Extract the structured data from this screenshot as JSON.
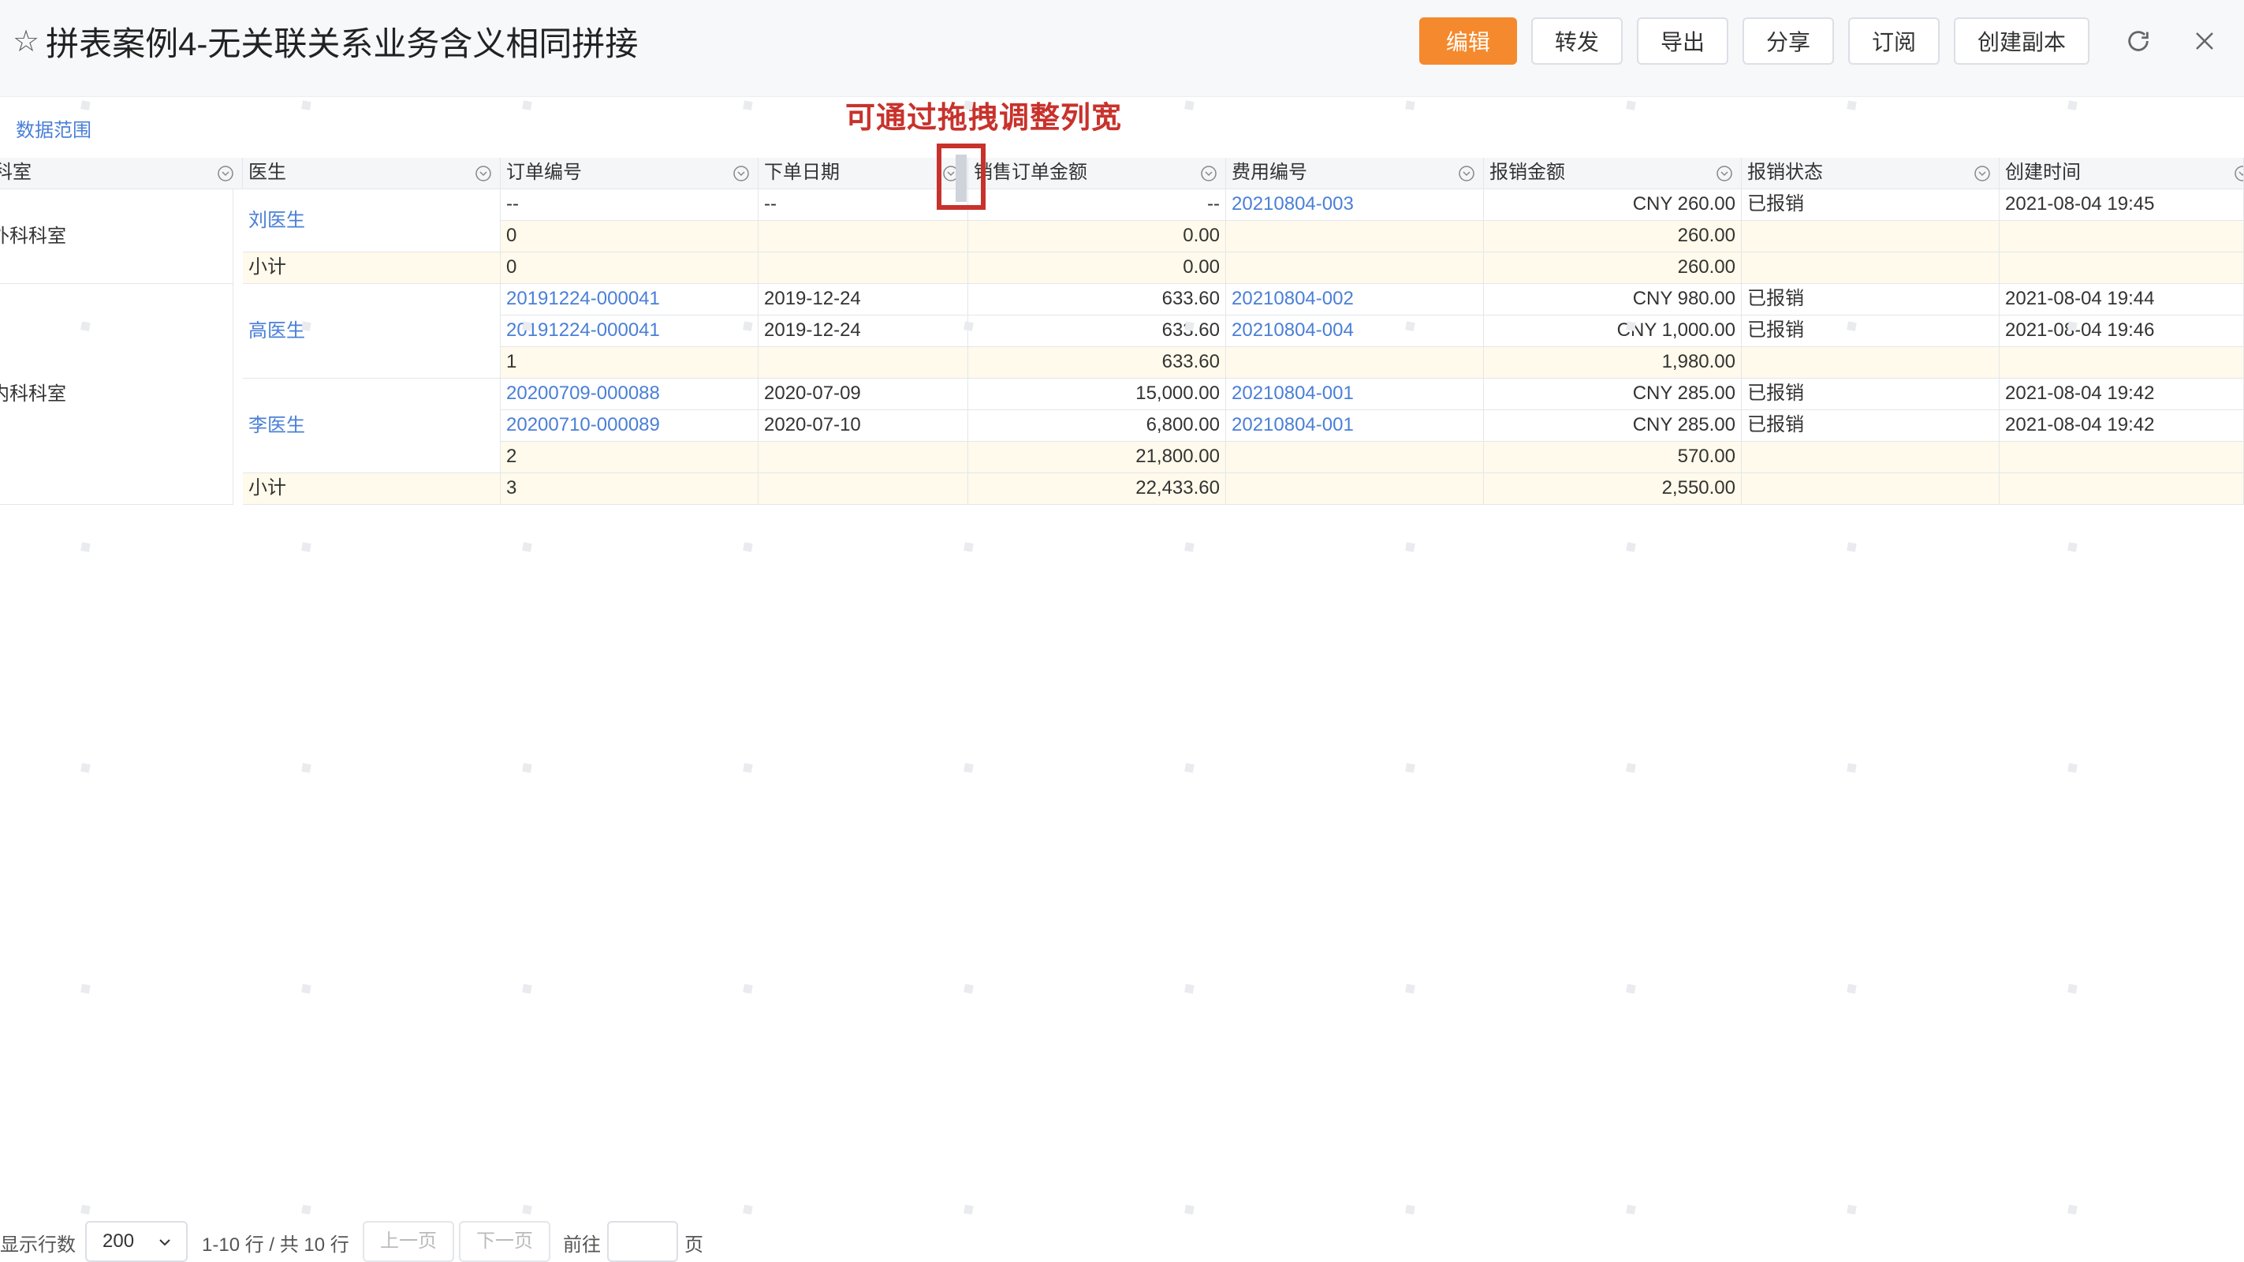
{
  "header": {
    "title": "拼表案例4-无关联关系业务含义相同拼接",
    "buttons": {
      "edit": "编辑",
      "forward": "转发",
      "export": "导出",
      "share": "分享",
      "subscribe": "订阅",
      "copy": "创建副本"
    },
    "accent": "#f5892d"
  },
  "data_range": "数据范围",
  "annotation": "可通过拖拽调整列宽",
  "table": {
    "columns": [
      "科室",
      "医生",
      "订单编号",
      "下单日期",
      "销售订单金额",
      "费用编号",
      "报销金额",
      "报销状态",
      "创建时间"
    ],
    "departments": [
      "外科科室",
      "内科科室"
    ],
    "doctors": [
      "刘医生",
      "高医生",
      "李医生"
    ],
    "rows": [
      {
        "order": "--",
        "date": "--",
        "amount": "--",
        "fee": "20210804-003",
        "reimb": "CNY 260.00",
        "status": "已报销",
        "created": "2021-08-04 19:45"
      },
      {
        "order": "0",
        "date": "",
        "amount": "0.00",
        "fee": "",
        "reimb": "260.00",
        "status": "",
        "created": ""
      },
      {
        "order": "0",
        "date": "",
        "amount": "0.00",
        "fee": "",
        "reimb": "260.00",
        "status": "",
        "created": ""
      },
      {
        "order": "20191224-000041",
        "date": "2019-12-24",
        "amount": "633.60",
        "fee": "20210804-002",
        "reimb": "CNY 980.00",
        "status": "已报销",
        "created": "2021-08-04 19:44"
      },
      {
        "order": "20191224-000041",
        "date": "2019-12-24",
        "amount": "633.60",
        "fee": "20210804-004",
        "reimb": "CNY 1,000.00",
        "status": "已报销",
        "created": "2021-08-04 19:46"
      },
      {
        "order": "1",
        "date": "",
        "amount": "633.60",
        "fee": "",
        "reimb": "1,980.00",
        "status": "",
        "created": ""
      },
      {
        "order": "20200709-000088",
        "date": "2020-07-09",
        "amount": "15,000.00",
        "fee": "20210804-001",
        "reimb": "CNY 285.00",
        "status": "已报销",
        "created": "2021-08-04 19:42"
      },
      {
        "order": "20200710-000089",
        "date": "2020-07-10",
        "amount": "6,800.00",
        "fee": "20210804-001",
        "reimb": "CNY 285.00",
        "status": "已报销",
        "created": "2021-08-04 19:42"
      },
      {
        "order": "2",
        "date": "",
        "amount": "21,800.00",
        "fee": "",
        "reimb": "570.00",
        "status": "",
        "created": ""
      },
      {
        "order": "3",
        "date": "",
        "amount": "22,433.60",
        "fee": "",
        "reimb": "2,550.00",
        "status": "",
        "created": ""
      }
    ],
    "subtotal_label": "小计"
  },
  "footer": {
    "rows_label": "显示行数",
    "page_size": "200",
    "count": "1-10 行 / 共 10 行",
    "prev": "上一页",
    "next": "下一页",
    "goto": "前往",
    "page_suffix": "页"
  }
}
